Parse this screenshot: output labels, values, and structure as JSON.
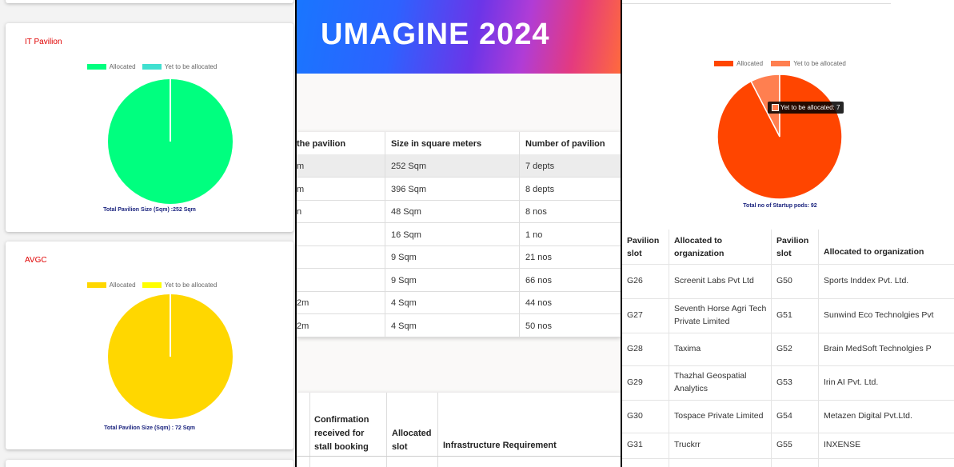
{
  "left": {
    "cards": [
      {
        "title": "IT Pavilion",
        "legend": [
          "Allocated",
          "Yet to be allocated"
        ],
        "colors": {
          "allocated": "#00ff7f",
          "yet": "#40e0d0"
        },
        "caption": "Total Pavilion Size (Sqm) :252 Sqm"
      },
      {
        "title": "AVGC",
        "legend": [
          "Allocated",
          "Yet to be allocated"
        ],
        "colors": {
          "allocated": "#ffd700",
          "yet": "#ffff00"
        },
        "caption": "Total Pavilion Size (Sqm) : 72 Sqm"
      }
    ]
  },
  "middle": {
    "banner": "UMAGINE 2024",
    "table_headers": [
      "the pavilion",
      "Size in square meters",
      "Number of pavilion"
    ],
    "rows": [
      {
        "a": "m",
        "size": "252 Sqm",
        "count": "7 depts"
      },
      {
        "a": "m",
        "size": "396 Sqm",
        "count": "8 depts"
      },
      {
        "a": "n",
        "size": "48 Sqm",
        "count": "8 nos"
      },
      {
        "a": "",
        "size": "16 Sqm",
        "count": "1 no"
      },
      {
        "a": "",
        "size": "9 Sqm",
        "count": "21 nos"
      },
      {
        "a": "",
        "size": "9 Sqm",
        "count": "66 nos"
      },
      {
        "a": "2m",
        "size": "4 Sqm",
        "count": "44 nos"
      },
      {
        "a": "2m",
        "size": "4 Sqm",
        "count": "50 nos"
      }
    ],
    "bottom_headers": {
      "confirmation": [
        "Confirmation",
        "received for",
        "stall booking"
      ],
      "slot": [
        "Allocated",
        "slot"
      ],
      "infra": "Infrastructure Requirement"
    }
  },
  "right": {
    "legend": [
      "Allocated",
      "Yet to be allocated"
    ],
    "colors": {
      "allocated": "#ff4500",
      "yet": "#ff7f50"
    },
    "tooltip": "Yet to be allocated: 7",
    "caption": "Total no of Startup pods: 92",
    "headers": {
      "slot1": [
        "Pavilion",
        "slot"
      ],
      "org1": [
        "Allocated to",
        "organization"
      ],
      "slot2": [
        "Pavilion",
        "slot"
      ],
      "org2": "Allocated to organization"
    },
    "rows": [
      {
        "s1": "G26",
        "o1": [
          "Screenit Labs Pvt Ltd"
        ],
        "s2": "G50",
        "o2": "Sports Inddex Pvt. Ltd."
      },
      {
        "s1": "G27",
        "o1": [
          "Seventh Horse Agri Tech",
          "Private Limited"
        ],
        "s2": "G51",
        "o2": "Sunwind Eco Technolgies Pvt"
      },
      {
        "s1": "G28",
        "o1": [
          "Taxima"
        ],
        "s2": "G52",
        "o2": "Brain MedSoft Technolgies P"
      },
      {
        "s1": "G29",
        "o1": [
          "Thazhal Geospatial",
          "Analytics"
        ],
        "s2": "G53",
        "o2": "Irin AI Pvt. Ltd."
      },
      {
        "s1": "G30",
        "o1": [
          "Tospace Private Limited"
        ],
        "s2": "G54",
        "o2": "Metazen Digital Pvt.Ltd."
      },
      {
        "s1": "G31",
        "o1": [
          "Truckrr"
        ],
        "s2": "G55",
        "o2": "INXENSE"
      }
    ]
  },
  "chart_data": [
    {
      "type": "pie",
      "title": "IT Pavilion",
      "categories": [
        "Allocated",
        "Yet to be allocated"
      ],
      "values": [
        252,
        0
      ]
    },
    {
      "type": "pie",
      "title": "AVGC",
      "categories": [
        "Allocated",
        "Yet to be allocated"
      ],
      "values": [
        72,
        0
      ]
    },
    {
      "type": "pie",
      "title": "",
      "categories": [
        "Allocated",
        "Yet to be allocated"
      ],
      "values": [
        85,
        7
      ]
    }
  ]
}
